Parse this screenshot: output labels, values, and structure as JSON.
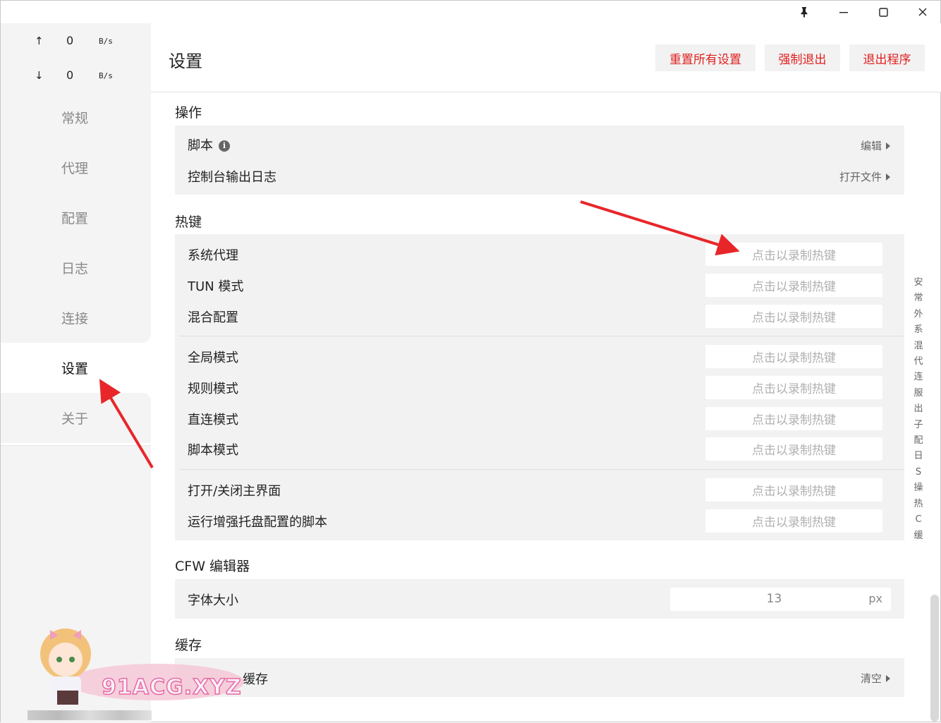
{
  "titlebar": {
    "pin_icon": "pin-icon",
    "minimize_icon": "minimize-icon",
    "maximize_icon": "maximize-icon",
    "close_icon": "close-icon"
  },
  "traffic": {
    "up_arrow": "↑",
    "up_value": "0",
    "up_unit": "B/s",
    "down_arrow": "↓",
    "down_value": "0",
    "down_unit": "B/s"
  },
  "sidebar": {
    "items": [
      {
        "label": "常规"
      },
      {
        "label": "代理"
      },
      {
        "label": "配置"
      },
      {
        "label": "日志"
      },
      {
        "label": "连接"
      },
      {
        "label": "设置"
      },
      {
        "label": "关于"
      }
    ],
    "active": "设置"
  },
  "header": {
    "title": "设置",
    "reset_label": "重置所有设置",
    "force_quit_label": "强制退出",
    "quit_label": "退出程序",
    "button_color": "#e02020"
  },
  "sections": {
    "operations": {
      "title": "操作",
      "script_label": "脚本",
      "script_action": "编辑",
      "console_label": "控制台输出日志",
      "console_action": "打开文件"
    },
    "hotkeys": {
      "title": "热键",
      "placeholder": "点击以录制热键",
      "rows": [
        {
          "label": "系统代理"
        },
        {
          "label": "TUN 模式"
        },
        {
          "label": "混合配置"
        },
        {
          "label": "全局模式"
        },
        {
          "label": "规则模式"
        },
        {
          "label": "直连模式"
        },
        {
          "label": "脚本模式"
        },
        {
          "label": "打开/关闭主界面"
        },
        {
          "label": "运行增强托盘配置的脚本"
        }
      ]
    },
    "editor": {
      "title": "CFW 编辑器",
      "font_size_label": "字体大小",
      "font_size_value": "13",
      "font_size_unit": "px"
    },
    "cache": {
      "title": "缓存",
      "row_label": "缓存",
      "row_action": "清空"
    }
  },
  "side_index": [
    "安",
    "常",
    "外",
    "系",
    "混",
    "代",
    "连",
    "服",
    "出",
    "子",
    "配",
    "日",
    "S",
    "操",
    "热",
    "C",
    "缓"
  ],
  "watermark": {
    "text": "91ACG.XYZ"
  }
}
